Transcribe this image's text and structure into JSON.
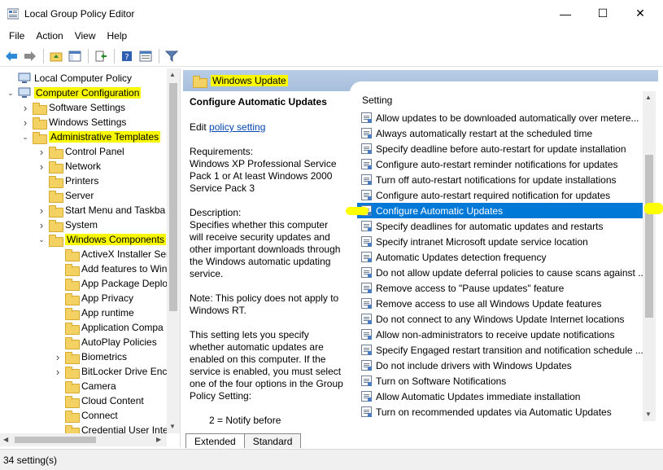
{
  "window": {
    "title": "Local Group Policy Editor",
    "min_glyph": "—",
    "max_glyph": "☐",
    "close_glyph": "✕"
  },
  "menu": [
    "File",
    "Action",
    "View",
    "Help"
  ],
  "tree": {
    "items": [
      {
        "label": "Local Computer Policy",
        "level": 0,
        "arrow": "",
        "icon": "computer-icon"
      },
      {
        "label": "Computer Configuration",
        "level": 0,
        "arrow": "v",
        "icon": "computer-icon",
        "highlight": true
      },
      {
        "label": "Software Settings",
        "level": 1,
        "arrow": ">",
        "icon": "folder-icon"
      },
      {
        "label": "Windows Settings",
        "level": 1,
        "arrow": ">",
        "icon": "folder-icon"
      },
      {
        "label": "Administrative Templates",
        "level": 1,
        "arrow": "v",
        "icon": "folder-icon",
        "highlight": true
      },
      {
        "label": "Control Panel",
        "level": 2,
        "arrow": ">",
        "icon": "folder-icon"
      },
      {
        "label": "Network",
        "level": 2,
        "arrow": ">",
        "icon": "folder-icon"
      },
      {
        "label": "Printers",
        "level": 2,
        "arrow": "",
        "icon": "folder-icon"
      },
      {
        "label": "Server",
        "level": 2,
        "arrow": "",
        "icon": "folder-icon"
      },
      {
        "label": "Start Menu and Taskba",
        "level": 2,
        "arrow": ">",
        "icon": "folder-icon"
      },
      {
        "label": "System",
        "level": 2,
        "arrow": ">",
        "icon": "folder-icon"
      },
      {
        "label": "Windows Components",
        "level": 2,
        "arrow": "v",
        "icon": "folder-icon",
        "highlight": true
      },
      {
        "label": "ActiveX Installer Ser",
        "level": 3,
        "arrow": "",
        "icon": "folder-icon"
      },
      {
        "label": "Add features to Win",
        "level": 3,
        "arrow": "",
        "icon": "folder-icon"
      },
      {
        "label": "App Package Deplo",
        "level": 3,
        "arrow": "",
        "icon": "folder-icon"
      },
      {
        "label": "App Privacy",
        "level": 3,
        "arrow": "",
        "icon": "folder-icon"
      },
      {
        "label": "App runtime",
        "level": 3,
        "arrow": "",
        "icon": "folder-icon"
      },
      {
        "label": "Application Compa",
        "level": 3,
        "arrow": "",
        "icon": "folder-icon"
      },
      {
        "label": "AutoPlay Policies",
        "level": 3,
        "arrow": "",
        "icon": "folder-icon"
      },
      {
        "label": "Biometrics",
        "level": 3,
        "arrow": ">",
        "icon": "folder-icon"
      },
      {
        "label": "BitLocker Drive Enc",
        "level": 3,
        "arrow": ">",
        "icon": "folder-icon"
      },
      {
        "label": "Camera",
        "level": 3,
        "arrow": "",
        "icon": "folder-icon"
      },
      {
        "label": "Cloud Content",
        "level": 3,
        "arrow": "",
        "icon": "folder-icon"
      },
      {
        "label": "Connect",
        "level": 3,
        "arrow": "",
        "icon": "folder-icon"
      },
      {
        "label": "Credential User Inte",
        "level": 3,
        "arrow": "",
        "icon": "folder-icon"
      }
    ]
  },
  "right_header": {
    "title": "Windows Update"
  },
  "description": {
    "title": "Configure Automatic Updates",
    "edit_prefix": "Edit ",
    "edit_link": "policy setting",
    "requirements": "Requirements:\nWindows XP Professional Service Pack 1 or At least Windows 2000 Service Pack 3",
    "description": "Description:\nSpecifies whether this computer will receive security updates and other important downloads through the Windows automatic updating service.",
    "note": "Note: This policy does not apply to Windows RT.",
    "setting_text": "This setting lets you specify whether automatic updates are enabled on this computer. If the service is enabled, you must select one of the four options in the Group Policy Setting:",
    "option": "2 = Notify before"
  },
  "list": {
    "header": "Setting",
    "rows": [
      "Allow updates to be downloaded automatically over metere...",
      "Always automatically restart at the scheduled time",
      "Specify deadline before auto-restart for update installation",
      "Configure auto-restart reminder notifications for updates",
      "Turn off auto-restart notifications for update installations",
      "Configure auto-restart required notification for updates",
      "Configure Automatic Updates",
      "Specify deadlines for automatic updates and restarts",
      "Specify intranet Microsoft update service location",
      "Automatic Updates detection frequency",
      "Do not allow update deferral policies to cause scans against ...",
      "Remove access to \"Pause updates\" feature",
      "Remove access to use all Windows Update features",
      "Do not connect to any Windows Update Internet locations",
      "Allow non-administrators to receive update notifications",
      "Specify Engaged restart transition and notification schedule ...",
      "Do not include drivers with Windows Updates",
      "Turn on Software Notifications",
      "Allow Automatic Updates immediate installation",
      "Turn on recommended updates via Automatic Updates"
    ],
    "selected_index": 6
  },
  "tabs": [
    "Extended",
    "Standard"
  ],
  "status": {
    "text": "34 setting(s)"
  },
  "colors": {
    "selection": "#0078d7",
    "highlight": "#ffff00",
    "header": "#b8cde6"
  }
}
